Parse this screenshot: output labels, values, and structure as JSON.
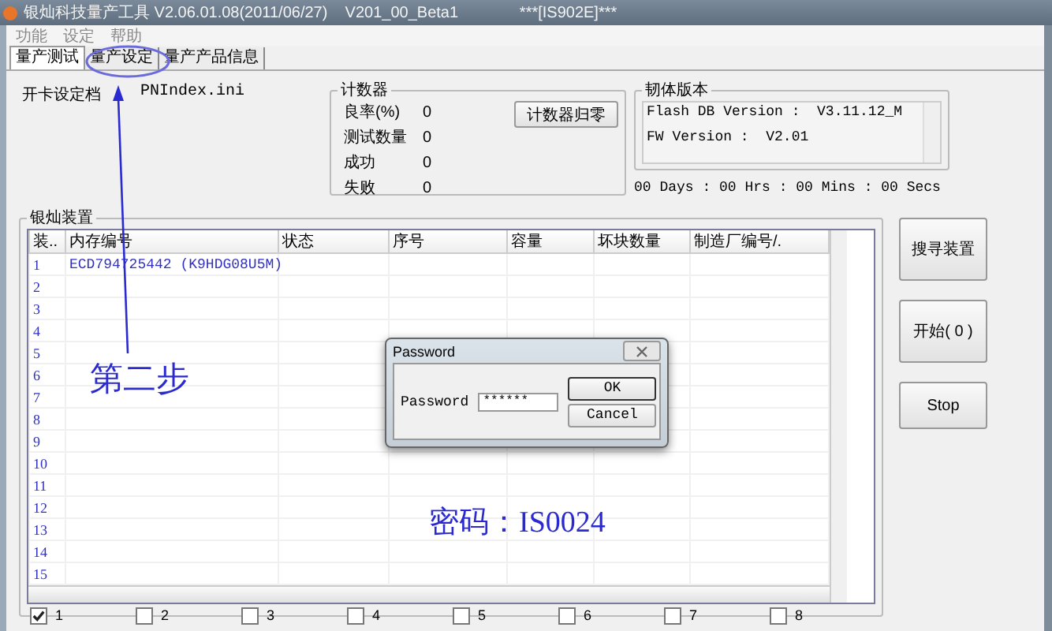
{
  "window": {
    "title": "银灿科技量产工具 V2.06.01.08(2011/06/27)    V201_00_Beta1              ***[IS902E]***"
  },
  "menu": [
    "功能",
    "设定",
    "帮助"
  ],
  "tabs": [
    {
      "label": "量产测试",
      "selected": true
    },
    {
      "label": "量产设定",
      "selected": false
    },
    {
      "label": "量产产品信息",
      "selected": false
    }
  ],
  "settings_file": {
    "label": "开卡设定档",
    "value": "PNIndex.ini"
  },
  "counter": {
    "title": "计数器",
    "reset_button": "计数器归零",
    "rows": [
      {
        "label": "良率(%)",
        "value": "0"
      },
      {
        "label": "测试数量",
        "value": "0"
      },
      {
        "label": "成功",
        "value": "0"
      },
      {
        "label": "失败",
        "value": "0"
      }
    ]
  },
  "firmware": {
    "title": "韧体版本",
    "lines": [
      "Flash DB Version :  V3.11.12_M",
      "FW Version :  V2.01"
    ]
  },
  "timer": "00 Days : 00 Hrs : 00 Mins : 00 Secs",
  "devices": {
    "title": "银灿装置",
    "columns": [
      "装..",
      "内存编号",
      "状态",
      "序号",
      "容量",
      "坏块数量",
      "制造厂编号/."
    ],
    "rows": [
      {
        "index": "1",
        "memory_id": "ECD794725442 (K9HDG08U5M)"
      },
      {
        "index": "2"
      },
      {
        "index": "3"
      },
      {
        "index": "4"
      },
      {
        "index": "5"
      },
      {
        "index": "6"
      },
      {
        "index": "7"
      },
      {
        "index": "8"
      },
      {
        "index": "9"
      },
      {
        "index": "10"
      },
      {
        "index": "11"
      },
      {
        "index": "12"
      },
      {
        "index": "13"
      },
      {
        "index": "14"
      },
      {
        "index": "15"
      }
    ],
    "ports": [
      {
        "label": "1",
        "checked": true
      },
      {
        "label": "2",
        "checked": false
      },
      {
        "label": "3",
        "checked": false
      },
      {
        "label": "4",
        "checked": false
      },
      {
        "label": "5",
        "checked": false
      },
      {
        "label": "6",
        "checked": false
      },
      {
        "label": "7",
        "checked": false
      },
      {
        "label": "8",
        "checked": false
      }
    ]
  },
  "actions": [
    "搜寻装置",
    "开始( 0 )",
    "Stop"
  ],
  "dialog": {
    "title": "Password",
    "label": "Password",
    "value": "******",
    "buttons": [
      "OK",
      "Cancel"
    ]
  },
  "annotations": [
    {
      "kind": "step",
      "text": "第二步"
    },
    {
      "kind": "note",
      "text": "密码：IS0024"
    }
  ]
}
